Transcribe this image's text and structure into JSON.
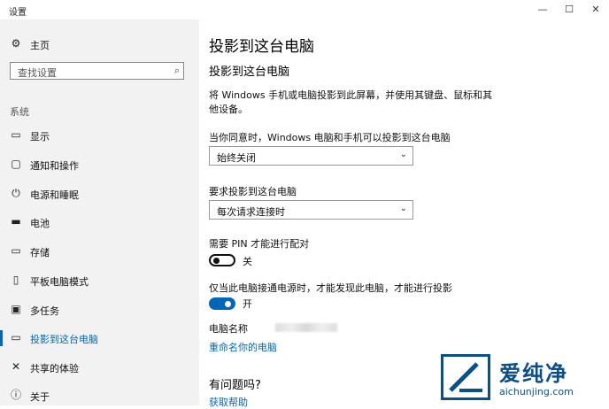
{
  "window": {
    "title": "设置",
    "minimize": "—",
    "maximize": "☐",
    "close": "✕"
  },
  "sidebar": {
    "home_label": "主页",
    "search_placeholder": "查找设置",
    "group_label": "系统",
    "items": [
      {
        "label": "显示",
        "icon": "display-icon"
      },
      {
        "label": "通知和操作",
        "icon": "notification-icon"
      },
      {
        "label": "电源和睡眠",
        "icon": "power-icon"
      },
      {
        "label": "电池",
        "icon": "battery-icon"
      },
      {
        "label": "存储",
        "icon": "storage-icon"
      },
      {
        "label": "平板电脑模式",
        "icon": "tablet-icon"
      },
      {
        "label": "多任务",
        "icon": "multitask-icon"
      },
      {
        "label": "投影到这台电脑",
        "icon": "projecting-icon",
        "active": true
      },
      {
        "label": "共享的体验",
        "icon": "shared-experiences-icon"
      },
      {
        "label": "关于",
        "icon": "about-icon"
      }
    ]
  },
  "main": {
    "page_title": "投影到这台电脑",
    "section_title": "投影到这台电脑",
    "description": "将 Windows 手机或电脑投影到此屏幕，并使用其键盘、鼠标和其他设备。",
    "availability_label": "当你同意时，Windows 电脑和手机可以投影到这台电脑",
    "availability_value": "始终关闭",
    "ask_label": "要求投影到这台电脑",
    "ask_value": "每次请求连接时",
    "pin_label": "需要 PIN 才能进行配对",
    "pin_state": "关",
    "power_label": "仅当此电脑接通电源时，才能发现此电脑，才能进行投影",
    "power_state": "开",
    "pc_name_label": "电脑名称",
    "rename_link": "重命名你的电脑",
    "help_title": "有问题吗?",
    "help_link": "获取帮助"
  },
  "watermark": {
    "cn": "爱纯净",
    "en": "aichunjing.com"
  },
  "colors": {
    "accent": "#0067b8",
    "sidebar_bg": "#f2f2f2"
  }
}
